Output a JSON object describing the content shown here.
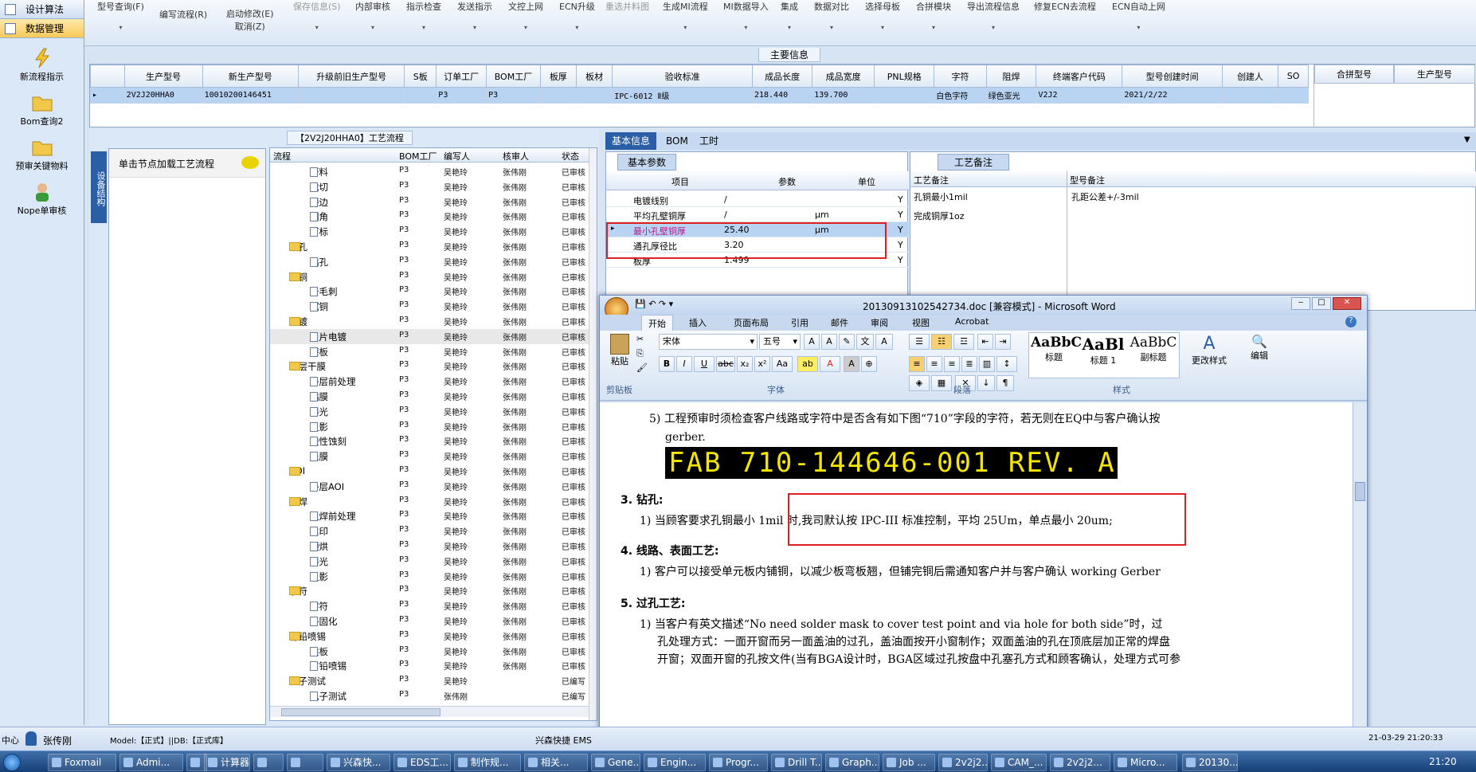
{
  "leftnav": {
    "items": [
      {
        "label": "设计算法",
        "selected": false
      },
      {
        "label": "数据管理",
        "selected": true
      }
    ],
    "icons": [
      {
        "label": "新流程指示",
        "icon": "lightning-icon"
      },
      {
        "label": "Bom查询2",
        "icon": "folder-icon"
      },
      {
        "label": "预审关键物料",
        "icon": "folder-icon"
      },
      {
        "label": "Nope单审核",
        "icon": "user-icon"
      }
    ]
  },
  "toolbar": {
    "buttons": [
      {
        "label": "型号查询(F)",
        "dd": "▾"
      },
      {
        "label": "编写流程(R)",
        "dd": ""
      },
      {
        "label": "启动修改(E)",
        "label2": "取消(Z)",
        "dd": ""
      },
      {
        "label": "保存信息(S)",
        "dd": "▾"
      },
      {
        "label": "内部审核",
        "dd": "▾"
      },
      {
        "label": "指示检查",
        "dd": "▾"
      },
      {
        "label": "发送指示",
        "dd": "▾"
      },
      {
        "label": "文控上网",
        "dd": "▾"
      },
      {
        "label": "ECN升级",
        "dd": "▾"
      },
      {
        "label": "重选并料图",
        "dd": ""
      },
      {
        "label": "生成MI流程",
        "dd": "▾"
      },
      {
        "label": "MI数据导入",
        "dd": "▾"
      },
      {
        "label": "集成",
        "dd": "▾"
      },
      {
        "label": "数据对比",
        "dd": "▾"
      },
      {
        "label": "选择母板",
        "dd": "▾"
      },
      {
        "label": "合拼模块",
        "dd": "▾"
      },
      {
        "label": "导出流程信息",
        "dd": "▾"
      },
      {
        "label": "修复ECN去流程",
        "dd": ""
      },
      {
        "label": "ECN自动上网",
        "dd": "▾"
      }
    ]
  },
  "main_info": {
    "title": "主要信息",
    "headers": [
      "生产型号",
      "新生产型号",
      "升级前旧生产型号",
      "S板",
      "订单工厂",
      "BOM工厂",
      "板厚",
      "板材",
      "验收标准",
      "成品长度",
      "成品宽度",
      "PNL规格",
      "字符",
      "阻焊",
      "终端客户代码",
      "型号创建时间",
      "创建人",
      "SO"
    ],
    "row": [
      "2V2J20HHA0",
      "10010200146451",
      "",
      "",
      "P3",
      "P3",
      "",
      "",
      "IPC-6012 Ⅱ级",
      "218.440",
      "139.700",
      "",
      "白色字符",
      "绿色亚光",
      "V2J2",
      "2021/2/22",
      "",
      ""
    ],
    "right_headers": [
      "合拼型号",
      "生产型号"
    ]
  },
  "process_panel": {
    "title": "【2V2J20HHA0】工艺流程",
    "vertical_tab": "设备结构",
    "load_hint": "单击节点加载工艺流程",
    "headers": [
      "流程",
      "BOM工厂",
      "编写人",
      "核审人",
      "状态"
    ],
    "rows": [
      {
        "name": "开料",
        "level": 1,
        "type": "doc",
        "bom": "P3",
        "writer": "吴艳玲",
        "reviewer": "张伟刚",
        "status": "已审核"
      },
      {
        "name": "裁切",
        "level": 1,
        "type": "doc",
        "bom": "P3",
        "writer": "吴艳玲",
        "reviewer": "张伟刚",
        "status": "已审核"
      },
      {
        "name": "磨边",
        "level": 1,
        "type": "doc",
        "bom": "P3",
        "writer": "吴艳玲",
        "reviewer": "张伟刚",
        "status": "已审核"
      },
      {
        "name": "圆角",
        "level": 1,
        "type": "doc",
        "bom": "P3",
        "writer": "吴艳玲",
        "reviewer": "张伟刚",
        "status": "已审核"
      },
      {
        "name": "打标",
        "level": 1,
        "type": "doc",
        "bom": "P3",
        "writer": "吴艳玲",
        "reviewer": "张伟刚",
        "status": "已审核"
      },
      {
        "name": "钻孔",
        "level": 0,
        "type": "folder",
        "bom": "P3",
        "writer": "吴艳玲",
        "reviewer": "张伟刚",
        "status": "已审核"
      },
      {
        "name": "钻孔",
        "level": 1,
        "type": "doc",
        "bom": "P3",
        "writer": "吴艳玲",
        "reviewer": "张伟刚",
        "status": "已审核"
      },
      {
        "name": "沉铜",
        "level": 0,
        "type": "folder",
        "bom": "P3",
        "writer": "吴艳玲",
        "reviewer": "张伟刚",
        "status": "已审核"
      },
      {
        "name": "去毛刺",
        "level": 1,
        "type": "doc",
        "bom": "P3",
        "writer": "吴艳玲",
        "reviewer": "张伟刚",
        "status": "已审核"
      },
      {
        "name": "沉铜",
        "level": 1,
        "type": "doc",
        "bom": "P3",
        "writer": "吴艳玲",
        "reviewer": "张伟刚",
        "status": "已审核"
      },
      {
        "name": "电镀",
        "level": 0,
        "type": "folder",
        "bom": "P3",
        "writer": "吴艳玲",
        "reviewer": "张伟刚",
        "status": "已审核"
      },
      {
        "name": "负片电镀",
        "level": 1,
        "type": "doc",
        "bom": "P3",
        "writer": "吴艳玲",
        "reviewer": "张伟刚",
        "status": "已审核"
      },
      {
        "name": "磨板",
        "level": 1,
        "type": "doc",
        "bom": "P3",
        "writer": "吴艳玲",
        "reviewer": "张伟刚",
        "status": "已审核"
      },
      {
        "name": "外层干膜",
        "level": 0,
        "type": "folder",
        "bom": "P3",
        "writer": "吴艳玲",
        "reviewer": "张伟刚",
        "status": "已审核"
      },
      {
        "name": "外层前处理",
        "level": 1,
        "type": "doc",
        "bom": "P3",
        "writer": "吴艳玲",
        "reviewer": "张伟刚",
        "status": "已审核"
      },
      {
        "name": "贴膜",
        "level": 1,
        "type": "doc",
        "bom": "P3",
        "writer": "吴艳玲",
        "reviewer": "张伟刚",
        "status": "已审核"
      },
      {
        "name": "曝光",
        "level": 1,
        "type": "doc",
        "bom": "P3",
        "writer": "吴艳玲",
        "reviewer": "张伟刚",
        "status": "已审核"
      },
      {
        "name": "显影",
        "level": 1,
        "type": "doc",
        "bom": "P3",
        "writer": "吴艳玲",
        "reviewer": "张伟刚",
        "status": "已审核"
      },
      {
        "name": "酸性蚀刻",
        "level": 1,
        "type": "doc",
        "bom": "P3",
        "writer": "吴艳玲",
        "reviewer": "张伟刚",
        "status": "已审核"
      },
      {
        "name": "退膜",
        "level": 1,
        "type": "doc",
        "bom": "P3",
        "writer": "吴艳玲",
        "reviewer": "张伟刚",
        "status": "已审核"
      },
      {
        "name": "AOI",
        "level": 0,
        "type": "folder",
        "bom": "P3",
        "writer": "吴艳玲",
        "reviewer": "张伟刚",
        "status": "已审核"
      },
      {
        "name": "外层AOI",
        "level": 1,
        "type": "doc",
        "bom": "P3",
        "writer": "吴艳玲",
        "reviewer": "张伟刚",
        "status": "已审核"
      },
      {
        "name": "阻焊",
        "level": 0,
        "type": "folder",
        "bom": "P3",
        "writer": "吴艳玲",
        "reviewer": "张伟刚",
        "status": "已审核"
      },
      {
        "name": "阻焊前处理",
        "level": 1,
        "type": "doc",
        "bom": "P3",
        "writer": "吴艳玲",
        "reviewer": "张伟刚",
        "status": "已审核"
      },
      {
        "name": "丝印",
        "level": 1,
        "type": "doc",
        "bom": "P3",
        "writer": "吴艳玲",
        "reviewer": "张伟刚",
        "status": "已审核"
      },
      {
        "name": "预烘",
        "level": 1,
        "type": "doc",
        "bom": "P3",
        "writer": "吴艳玲",
        "reviewer": "张伟刚",
        "status": "已审核"
      },
      {
        "name": "曝光",
        "level": 1,
        "type": "doc",
        "bom": "P3",
        "writer": "吴艳玲",
        "reviewer": "张伟刚",
        "status": "已审核"
      },
      {
        "name": "显影",
        "level": 1,
        "type": "doc",
        "bom": "P3",
        "writer": "吴艳玲",
        "reviewer": "张伟刚",
        "status": "已审核"
      },
      {
        "name": "字符",
        "level": 0,
        "type": "folder",
        "bom": "P3",
        "writer": "吴艳玲",
        "reviewer": "张伟刚",
        "status": "已审核"
      },
      {
        "name": "字符",
        "level": 1,
        "type": "doc",
        "bom": "P3",
        "writer": "吴艳玲",
        "reviewer": "张伟刚",
        "status": "已审核"
      },
      {
        "name": "终固化",
        "level": 1,
        "type": "doc",
        "bom": "P3",
        "writer": "吴艳玲",
        "reviewer": "张伟刚",
        "status": "已审核"
      },
      {
        "name": "有铅喷锡",
        "level": 0,
        "type": "folder",
        "bom": "P3",
        "writer": "吴艳玲",
        "reviewer": "张伟刚",
        "status": "已审核"
      },
      {
        "name": "烘板",
        "level": 1,
        "type": "doc",
        "bom": "P3",
        "writer": "吴艳玲",
        "reviewer": "张伟刚",
        "status": "已审核"
      },
      {
        "name": "有铅喷锡",
        "level": 1,
        "type": "doc",
        "bom": "P3",
        "writer": "吴艳玲",
        "reviewer": "张伟刚",
        "status": "已审核"
      },
      {
        "name": "电子测试",
        "level": 0,
        "type": "folder",
        "bom": "P3",
        "writer": "吴艳玲",
        "reviewer": "",
        "status": "已编写"
      },
      {
        "name": "电子测试",
        "level": 1,
        "type": "doc",
        "bom": "P3",
        "writer": "张伟刚",
        "reviewer": "",
        "status": "已编写"
      }
    ]
  },
  "right_tabs": [
    "基本信息",
    "BOM",
    "工时"
  ],
  "basic_params": {
    "tab": "基本参数",
    "headers": [
      "项目",
      "参数",
      "单位"
    ],
    "rows": [
      {
        "item": "电镀线别",
        "value": "/",
        "unit": "",
        "flag": "Y"
      },
      {
        "item": "平均孔壁铜厚",
        "value": "/",
        "unit": "μm",
        "flag": "Y"
      },
      {
        "item": "最小孔壁铜厚",
        "value": "25.40",
        "unit": "μm",
        "flag": "Y"
      },
      {
        "item": "通孔厚径比",
        "value": "3.20",
        "unit": "",
        "flag": "Y"
      },
      {
        "item": "板厚",
        "value": "1.499",
        "unit": "",
        "flag": "Y"
      }
    ]
  },
  "process_notes": {
    "tab": "工艺备注",
    "col1": "工艺备注",
    "col2": "型号备注",
    "note1": "孔铜最小1mil",
    "note2": "完成铜厚1oz",
    "note3": "孔距公差+/-3mil"
  },
  "word": {
    "title": "20130913102542734.doc [兼容模式] - Microsoft Word",
    "tabs": [
      "开始",
      "插入",
      "页面布局",
      "引用",
      "邮件",
      "审阅",
      "视图",
      "Acrobat"
    ],
    "font": "宋体",
    "size": "五号",
    "groups": [
      "剪贴板",
      "字体",
      "段落",
      "样式"
    ],
    "paste": "粘贴",
    "styles": [
      {
        "sample": "AaBbC",
        "label": "标题"
      },
      {
        "sample": "AaBl",
        "label": "标题 1"
      },
      {
        "sample": "AaBbC",
        "label": "副标题"
      }
    ],
    "change_style": "更改样式",
    "edit": "编辑",
    "para5": "5) 工程预审时须检查客户线路或字符中是否含有如下图“710”字段的字符，若无则在EQ中与客户确认按",
    "para5b": "gerber.",
    "fab": "FAB 710-144646-001 REV. A",
    "h3": "3.  钻孔:",
    "p3": "1) 当顾客要求孔铜最小 1mil 时,我司默认按 IPC-III 标准控制，平均 25Um，单点最小 20um;",
    "h4": "4.  线路、表面工艺:",
    "p4": "1) 客户可以接受单元板内铺铜，以减少板弯板翘，但铺完铜后需通知客户并与客户确认 working Gerber",
    "h5": "5.  过孔工艺:",
    "p5a": "1) 当客户有英文描述“No need solder mask to cover test point and via hole for both side”时，过",
    "p5b": "孔处理方式：一面开窗而另一面盖油的过孔，盖油面按开小窗制作；双面盖油的孔在顶底层加正常的焊盘",
    "p5c": "开窗；双面开窗的孔按文件(当有BGA设计时，BGA区域过孔按盘中孔塞孔方式和顾客确认，处理方式可参"
  },
  "statusbar": {
    "left": "中心",
    "user": "张传刚",
    "model": "Model:【正式】||DB:【正式库】",
    "company": "兴森快捷 EMS",
    "datetime": "21-03-29 21:20:33"
  },
  "taskbar": {
    "items": [
      "Foxmail",
      "Admi...",
      "",
      "计算器",
      "",
      "",
      "兴森快...",
      "EDS工...",
      "制作规...",
      "相关...",
      "Gene...",
      "Engin...",
      "Progr...",
      "Drill T...",
      "Graph...",
      "Job ...",
      "2v2j2...",
      "CAM_...",
      "2v2j2...",
      "Micro...",
      "20130..."
    ],
    "clock": "21:20"
  },
  "colors": {
    "highlight": "#e02020",
    "accent": "#2a5fa6",
    "selected_row": "#b9d3f3",
    "pink_text": "#c0128a"
  }
}
